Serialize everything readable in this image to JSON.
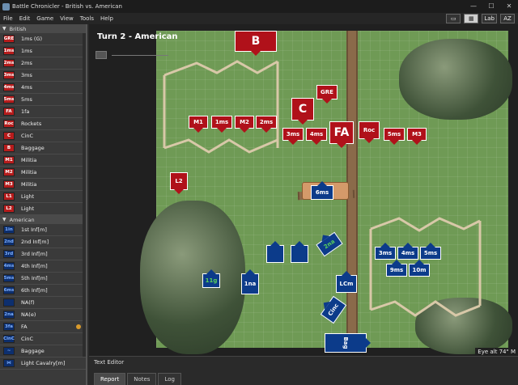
{
  "window": {
    "title": "Battle Chronicler - British vs. American",
    "controls": [
      "—",
      "☐",
      "✕"
    ]
  },
  "menu": [
    "File",
    "Edit",
    "Game",
    "View",
    "Tools",
    "Help"
  ],
  "toolbar": {
    "lab_label": "Lab",
    "az_label": "AZ"
  },
  "sidebar": {
    "british_header": "British",
    "american_header": "American",
    "british_units": [
      {
        "code": "GRE",
        "label": "1ms (G)"
      },
      {
        "code": "1ms",
        "label": "1ms"
      },
      {
        "code": "2ms",
        "label": "2ms"
      },
      {
        "code": "3ms",
        "label": "3ms"
      },
      {
        "code": "4ms",
        "label": "4ms"
      },
      {
        "code": "5ms",
        "label": "5ms"
      },
      {
        "code": "FA",
        "label": "1fa"
      },
      {
        "code": "Roc",
        "label": "Rockets"
      },
      {
        "code": "C",
        "label": "CinC"
      },
      {
        "code": "B",
        "label": "Baggage"
      },
      {
        "code": "M1",
        "label": "Militia"
      },
      {
        "code": "M2",
        "label": "Militia"
      },
      {
        "code": "M3",
        "label": "Militia"
      },
      {
        "code": "L1",
        "label": "Light"
      },
      {
        "code": "L2",
        "label": "Light"
      }
    ],
    "american_units": [
      {
        "code": "1in",
        "label": "1st Inf[m]"
      },
      {
        "code": "2nd",
        "label": "2nd Inf[m]"
      },
      {
        "code": "3rd",
        "label": "3rd Inf[m]"
      },
      {
        "code": "4ms",
        "label": "4th Inf[m]"
      },
      {
        "code": "5ms",
        "label": "5th Inf[m]"
      },
      {
        "code": "6ms",
        "label": "6th Inf[m]"
      },
      {
        "code": "",
        "label": "NA(f)"
      },
      {
        "code": "2na",
        "label": "NA(e)"
      },
      {
        "code": "3fa",
        "label": "FA"
      },
      {
        "code": "CinC",
        "label": "CinC"
      },
      {
        "code": "~",
        "label": "Baggage"
      },
      {
        "code": "⋈",
        "label": "Light Cavalry[m]"
      }
    ]
  },
  "map": {
    "turn_label": "Turn 2 - American",
    "status": "Eye alt 74\"  M",
    "british_counters": [
      "B",
      "GRE",
      "C",
      "M1",
      "1ms",
      "M2",
      "2ms",
      "3ms",
      "4ms",
      "FA",
      "Roc",
      "5ms",
      "M3",
      "L2"
    ],
    "american_counters": [
      "6ms",
      "2na",
      "3ms",
      "4ms",
      "5ms",
      "9ms",
      "10m",
      "11g",
      "1na",
      "LCm",
      "Cinc",
      "Bag"
    ]
  },
  "editor": {
    "title": "Text Editor",
    "tabs": [
      "Report",
      "Notes",
      "Log"
    ]
  }
}
